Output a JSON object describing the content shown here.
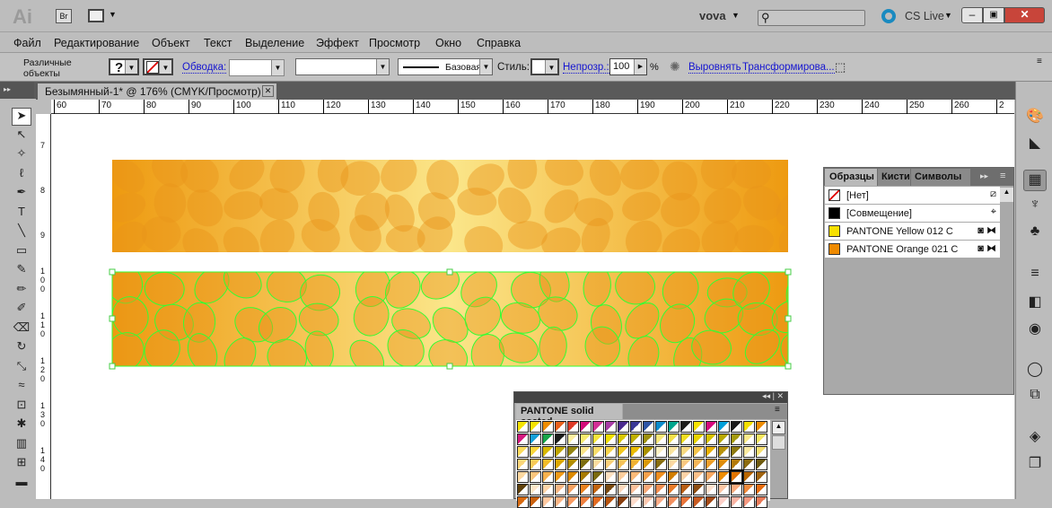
{
  "app": {
    "logo": "Ai",
    "bridge": "Br",
    "user": "vova",
    "search_placeholder": "",
    "cslive": "CS Live"
  },
  "menu": [
    "Файл",
    "Редактирование",
    "Объект",
    "Текст",
    "Выделение",
    "Эффект",
    "Просмотр",
    "Окно",
    "Справка"
  ],
  "control": {
    "selection": "Различные объекты",
    "fill": "?",
    "stroke_label": "Обводка:",
    "brush": "Базовая",
    "style_label": "Стиль:",
    "opacity_label": "Непрозр.:",
    "opacity_value": "100",
    "percent": "%",
    "align": "Выровнять",
    "transform": "Трансформирова..."
  },
  "document": {
    "tab": "Безымянный-1* @ 176% (CMYK/Просмотр)"
  },
  "rulers": {
    "h": [
      "60",
      "70",
      "80",
      "90",
      "100",
      "110",
      "120",
      "130",
      "140",
      "150",
      "160",
      "170",
      "180",
      "190",
      "200",
      "210",
      "220",
      "230",
      "240",
      "250",
      "260",
      "2"
    ],
    "v": [
      "7",
      "8",
      "9",
      "1\n0\n0",
      "1\n1\n0",
      "1\n2\n0",
      "1\n3\n0",
      "1\n4\n0"
    ]
  },
  "swatches": {
    "tabs": [
      "Образцы",
      "Кисти",
      "Символы"
    ],
    "items": [
      {
        "name": "[Нет]",
        "color": "none"
      },
      {
        "name": "[Совмещение]",
        "color": "#000000"
      },
      {
        "name": "PANTONE Yellow 012 C",
        "color": "#f7e000"
      },
      {
        "name": "PANTONE Orange 021 C",
        "color": "#ef8a00"
      }
    ]
  },
  "pantone": {
    "title": "PANTONE solid coated",
    "rows": [
      [
        "#f5e300",
        "#f7e200",
        "#ef8d00",
        "#e8601c",
        "#de3a26",
        "#d4087a",
        "#d22f95",
        "#a83ca6",
        "#4a2a8f",
        "#3a3896",
        "#2e55a5",
        "#0b8bcc",
        "#00a68e",
        "#1d1d1b",
        "#f7e200",
        "#d6087c",
        "#00a0da",
        "#1a1a1a",
        "#f5e000",
        "#ee8c00"
      ],
      [
        "#d41a80",
        "#15a0d8",
        "#19a64a",
        "#1c1c1a",
        "#fcf0a0",
        "#f8ea6e",
        "#f6e53a",
        "#f2df00",
        "#d9c800",
        "#bfb000",
        "#9d9010",
        "#f8e777",
        "#f4e04a",
        "#f0dd20",
        "#e9d400",
        "#d7c300",
        "#b8a800",
        "#a59a10",
        "#faea8a",
        "#f7e660"
      ],
      [
        "#fbdc5c",
        "#f9d63c",
        "#d8b800",
        "#bfa400",
        "#938410",
        "#fae48a",
        "#f8dc6a",
        "#f6d44c",
        "#f2c820",
        "#e9bb00",
        "#a99000",
        "#fbf0c2",
        "#fae4a0",
        "#f8d880",
        "#f4c44c",
        "#e9b000",
        "#b8920a",
        "#8e7a10",
        "#f9e9a0",
        "#f7e070"
      ],
      [
        "#fad67a",
        "#f8ca56",
        "#f2bc2a",
        "#dba600",
        "#b38e00",
        "#7d6e10",
        "#fbdc9e",
        "#f9cf7a",
        "#f6c35a",
        "#f0b232",
        "#d9990a",
        "#886e10",
        "#fbd9a2",
        "#f9c880",
        "#f5b658",
        "#ee9e2a",
        "#e08d0a",
        "#b47a0a",
        "#8d6c10",
        "#6e5a10"
      ],
      [
        "#fcd8a0",
        "#fbc57c",
        "#f7b24e",
        "#f09a18",
        "#dc8a00",
        "#a77a00",
        "#7a6a10",
        "#fde0c0",
        "#fccd9c",
        "#faba78",
        "#f6a14c",
        "#ef8e1e",
        "#d27e00",
        "#fcd2a6",
        "#fbc08a",
        "#f8a862",
        "#ee8c00",
        "#e07400",
        "#b86600",
        "#a16410"
      ],
      [
        "#60420c",
        "#fde6c8",
        "#fcd4a8",
        "#fab784",
        "#f5a060",
        "#ea8220",
        "#c26410",
        "#7a4a10",
        "#fcd8bc",
        "#fbc09a",
        "#f8a878",
        "#f28e50",
        "#e87a28",
        "#b85e14",
        "#8e4e12",
        "#fde0cc",
        "#fbc6a4",
        "#f9aa7c",
        "#ef8a3c",
        "#e66c10"
      ],
      [
        "#d86a10",
        "#c9600e",
        "#fdc8a0",
        "#fbb484",
        "#f89c64",
        "#ef8040",
        "#e26a20",
        "#b8540e",
        "#8a4010",
        "#fddccc",
        "#fcc8b0",
        "#f9ac88",
        "#f29060",
        "#e8743a",
        "#c85a20",
        "#a44a16",
        "#fdd0c8",
        "#fab4a4",
        "#f49880",
        "#e87a58"
      ]
    ]
  },
  "colors": {
    "accent_green": "#33ff33",
    "banner_orange": "#ee9a10",
    "banner_yellow": "#fbe68a"
  }
}
